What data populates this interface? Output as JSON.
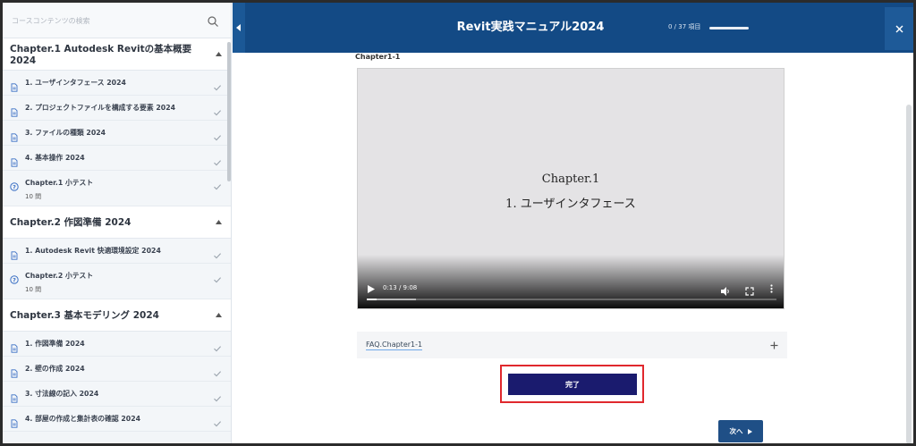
{
  "sidebar": {
    "search_placeholder": "コースコンテンツの検索",
    "chapters": [
      {
        "title": "Chapter.1 Autodesk Revitの基本概要 2024",
        "lessons": [
          {
            "label": "1. ユーザインタフェース 2024",
            "type": "doc"
          },
          {
            "label": "2. プロジェクトファイルを構成する要素 2024",
            "type": "doc"
          },
          {
            "label": "3. ファイルの種類 2024",
            "type": "doc"
          },
          {
            "label": "4. 基本操作 2024",
            "type": "doc"
          },
          {
            "label": "Chapter.1 小テスト",
            "sub": "10 問",
            "type": "quiz"
          }
        ]
      },
      {
        "title": "Chapter.2 作図準備 2024",
        "lessons": [
          {
            "label": "1. Autodesk Revit 快適環境設定 2024",
            "type": "doc"
          },
          {
            "label": "Chapter.2 小テスト",
            "sub": "10 問",
            "type": "quiz"
          }
        ]
      },
      {
        "title": "Chapter.3 基本モデリング 2024",
        "lessons": [
          {
            "label": "1. 作図準備 2024",
            "type": "doc"
          },
          {
            "label": "2. 壁の作成 2024",
            "type": "doc"
          },
          {
            "label": "3. 寸法線の記入 2024",
            "type": "doc"
          },
          {
            "label": "4. 部屋の作成と集計表の確認 2024",
            "type": "doc"
          }
        ]
      }
    ]
  },
  "header": {
    "title": "Revit実践マニュアル2024",
    "progress_text": "0 / 37 項目",
    "progress": 0
  },
  "content": {
    "section_label": "Chapter1-1",
    "video": {
      "line1": "Chapter.1",
      "line2": "1. ユーザインタフェース",
      "time": "0:13 / 9:08",
      "played_fraction": 0.024,
      "buffered_fraction": 0.12
    },
    "faq_label": "FAQ.Chapter1-1",
    "complete_label": "完了",
    "next_label": "次へ"
  },
  "colors": {
    "header_bg": "#134a85",
    "complete_bg": "#1a1b6e",
    "next_bg": "#1f4f86",
    "highlight": "#e0282d"
  }
}
